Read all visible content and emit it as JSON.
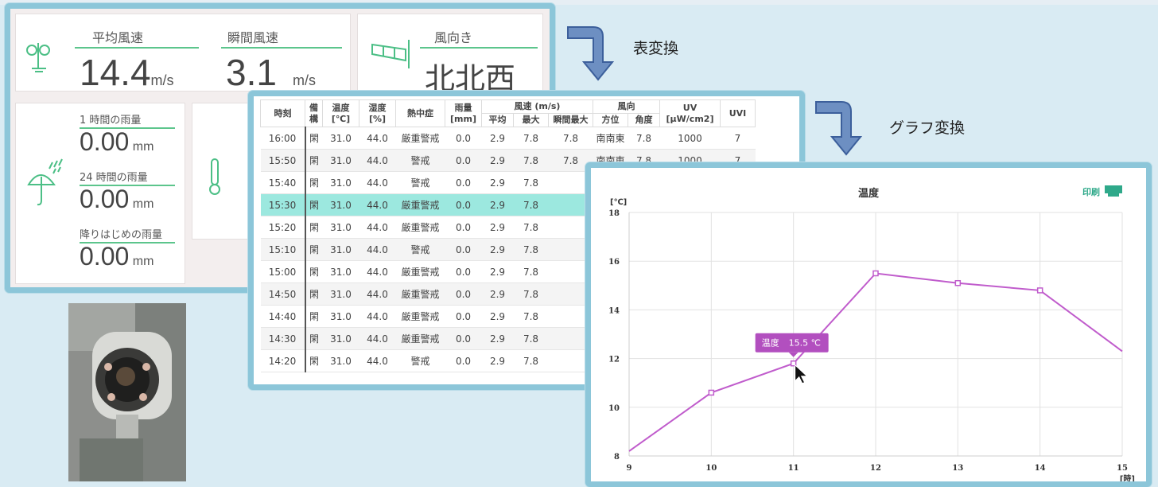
{
  "dashboard": {
    "avg_wind": {
      "label": "平均風速",
      "value": "14.4",
      "unit": "m/s"
    },
    "gust_wind": {
      "label": "瞬間風速",
      "value": "3.1",
      "unit": "m/s"
    },
    "wind_dir": {
      "label": "風向き",
      "value": "北北西"
    },
    "rain_1h": {
      "label": "1 時間の雨量",
      "value": "0.00",
      "unit": "mm"
    },
    "rain_24h": {
      "label": "24 時間の雨量",
      "value": "0.00",
      "unit": "mm"
    },
    "rain_start": {
      "label": "降りはじめの雨量",
      "value": "0.00",
      "unit": "mm"
    }
  },
  "captions": {
    "table": "表変換",
    "graph": "グラフ変換"
  },
  "table": {
    "headers": {
      "time": "時刻",
      "note": "備\n構",
      "temp": "温度\n[℃]",
      "humid": "湿度\n[%]",
      "heat": "熱中症",
      "rain": "雨量\n[mm]",
      "wind_group": "風速 (m/s)",
      "wind_avg": "平均",
      "wind_max": "最大",
      "wind_gust": "瞬間最大",
      "dir_group": "風向",
      "dir_name": "方位",
      "dir_angle": "角度",
      "uv": "UV\n[μW/cm2]",
      "uvi": "UVI"
    },
    "rows": [
      {
        "time": "16:00",
        "note": "閑",
        "temp": "31.0",
        "humid": "44.0",
        "heat": "厳重警戒",
        "rain": "0.0",
        "wavg": "2.9",
        "wmax": "7.8",
        "wgust": "7.8",
        "dir": "南南東",
        "angle": "7.8",
        "uv": "1000",
        "uvi": "7"
      },
      {
        "time": "15:50",
        "note": "閑",
        "temp": "31.0",
        "humid": "44.0",
        "heat": "警戒",
        "rain": "0.0",
        "wavg": "2.9",
        "wmax": "7.8",
        "wgust": "7.8",
        "dir": "南南東",
        "angle": "7.8",
        "uv": "1000",
        "uvi": "7"
      },
      {
        "time": "15:40",
        "note": "閑",
        "temp": "31.0",
        "humid": "44.0",
        "heat": "警戒",
        "rain": "0.0",
        "wavg": "2.9",
        "wmax": "7.8"
      },
      {
        "time": "15:30",
        "note": "閑",
        "temp": "31.0",
        "humid": "44.0",
        "heat": "厳重警戒",
        "rain": "0.0",
        "wavg": "2.9",
        "wmax": "7.8"
      },
      {
        "time": "15:20",
        "note": "閑",
        "temp": "31.0",
        "humid": "44.0",
        "heat": "厳重警戒",
        "rain": "0.0",
        "wavg": "2.9",
        "wmax": "7.8"
      },
      {
        "time": "15:10",
        "note": "閑",
        "temp": "31.0",
        "humid": "44.0",
        "heat": "警戒",
        "rain": "0.0",
        "wavg": "2.9",
        "wmax": "7.8"
      },
      {
        "time": "15:00",
        "note": "閑",
        "temp": "31.0",
        "humid": "44.0",
        "heat": "厳重警戒",
        "rain": "0.0",
        "wavg": "2.9",
        "wmax": "7.8"
      },
      {
        "time": "14:50",
        "note": "閑",
        "temp": "31.0",
        "humid": "44.0",
        "heat": "厳重警戒",
        "rain": "0.0",
        "wavg": "2.9",
        "wmax": "7.8"
      },
      {
        "time": "14:40",
        "note": "閑",
        "temp": "31.0",
        "humid": "44.0",
        "heat": "厳重警戒",
        "rain": "0.0",
        "wavg": "2.9",
        "wmax": "7.8"
      },
      {
        "time": "14:30",
        "note": "閑",
        "temp": "31.0",
        "humid": "44.0",
        "heat": "厳重警戒",
        "rain": "0.0",
        "wavg": "2.9",
        "wmax": "7.8"
      },
      {
        "time": "14:20",
        "note": "閑",
        "temp": "31.0",
        "humid": "44.0",
        "heat": "警戒",
        "rain": "0.0",
        "wavg": "2.9",
        "wmax": "7.8"
      }
    ],
    "selected_index": 3
  },
  "chart_data": {
    "type": "line",
    "title": "温度",
    "ylabel": "[℃]",
    "xlabel": "[時]",
    "x": [
      9,
      10,
      11,
      12,
      13,
      14,
      15
    ],
    "series": [
      {
        "name": "温度",
        "values": [
          8.2,
          10.6,
          11.8,
          15.5,
          15.1,
          14.8,
          12.3
        ]
      }
    ],
    "xlim": [
      9,
      15
    ],
    "ylim": [
      8,
      18
    ],
    "yticks": [
      8,
      10,
      12,
      14,
      16,
      18
    ],
    "xticks": [
      9,
      10,
      11,
      12,
      13,
      14,
      15
    ],
    "grid": true,
    "color": "#c05ccc",
    "tooltip": {
      "label": "温度",
      "value": "15.5 ℃",
      "index": 2
    },
    "print_label": "印刷"
  }
}
